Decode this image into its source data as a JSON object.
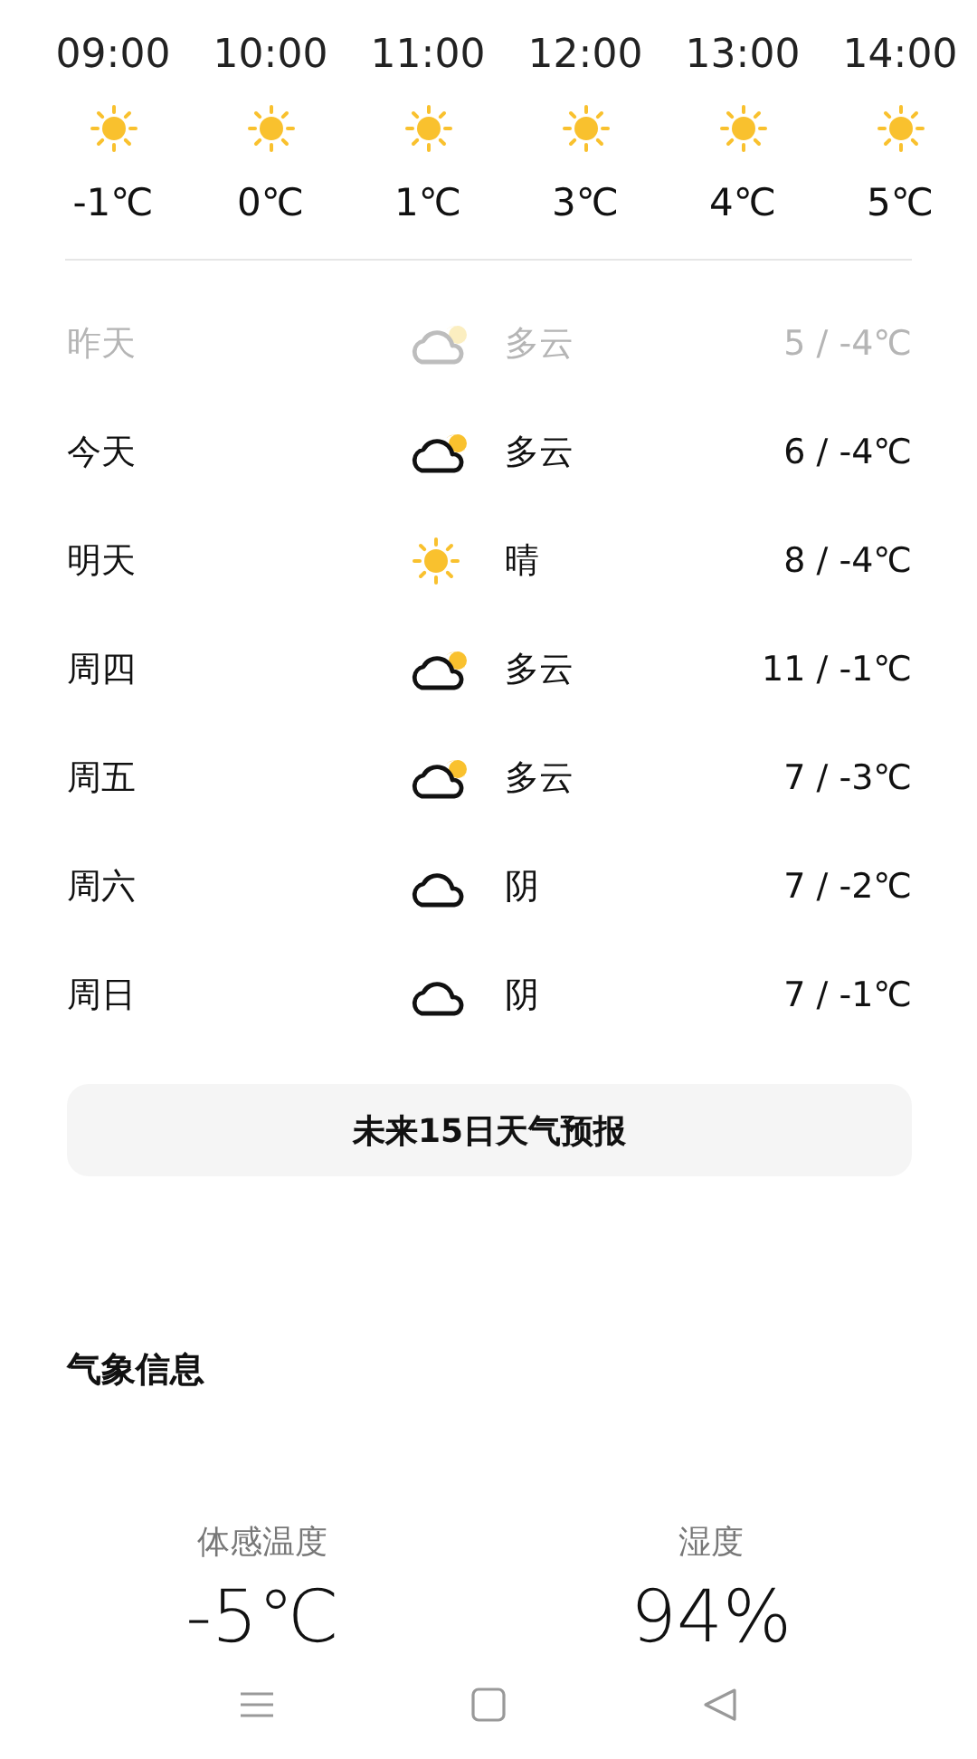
{
  "hourly": [
    {
      "time": "09:00",
      "kind": "sunny",
      "temp": "-1℃"
    },
    {
      "time": "10:00",
      "kind": "sunny",
      "temp": "0℃"
    },
    {
      "time": "11:00",
      "kind": "sunny",
      "temp": "1℃"
    },
    {
      "time": "12:00",
      "kind": "sunny",
      "temp": "3℃"
    },
    {
      "time": "13:00",
      "kind": "sunny",
      "temp": "4℃"
    },
    {
      "time": "14:00",
      "kind": "sunny",
      "temp": "5℃"
    }
  ],
  "daily": [
    {
      "day": "昨天",
      "kind": "partly_cloudy",
      "condition": "多云",
      "range": "5 / -4℃",
      "past": true
    },
    {
      "day": "今天",
      "kind": "partly_cloudy",
      "condition": "多云",
      "range": "6 / -4℃",
      "past": false
    },
    {
      "day": "明天",
      "kind": "sunny",
      "condition": "晴",
      "range": "8 / -4℃",
      "past": false
    },
    {
      "day": "周四",
      "kind": "partly_cloudy",
      "condition": "多云",
      "range": "11 / -1℃",
      "past": false
    },
    {
      "day": "周五",
      "kind": "partly_cloudy",
      "condition": "多云",
      "range": "7 / -3℃",
      "past": false
    },
    {
      "day": "周六",
      "kind": "overcast",
      "condition": "阴",
      "range": "7 / -2℃",
      "past": false
    },
    {
      "day": "周日",
      "kind": "overcast",
      "condition": "阴",
      "range": "7 / -1℃",
      "past": false
    }
  ],
  "forecast_button": "未来15日天气预报",
  "section_title": "气象信息",
  "metrics": [
    {
      "label": "体感温度",
      "value": "-5℃"
    },
    {
      "label": "湿度",
      "value": "94%"
    }
  ]
}
